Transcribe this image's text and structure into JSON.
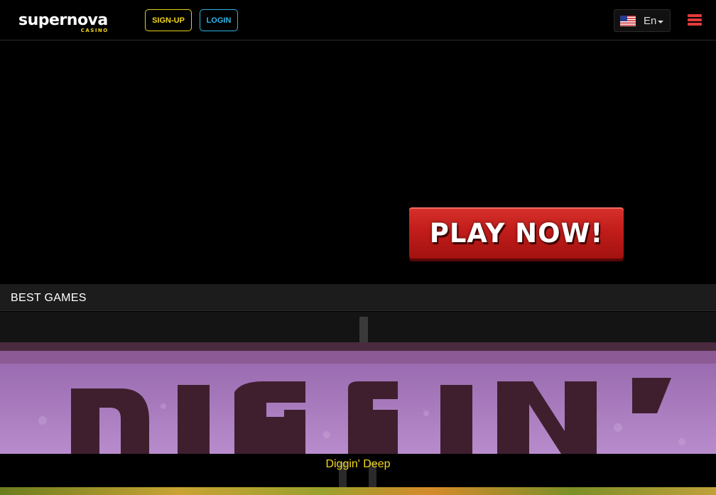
{
  "header": {
    "logo_text": "supernova",
    "logo_sub": "CASINO",
    "signup_label": "SIGN-UP",
    "login_label": "LOGIN",
    "language": "En",
    "flag_icon": "us-flag-icon",
    "menu_icon": "hamburger-menu-icon"
  },
  "hero": {
    "play_label": "PLAY NOW!"
  },
  "best_games": {
    "title": "BEST GAMES",
    "game": {
      "art_text": "DIGGIN'",
      "caption": "Diggin' Deep"
    }
  },
  "colors": {
    "signup": "#f2d61e",
    "login": "#2fb4e6",
    "menu": "#e53a3a",
    "play_button": "#c21d1a",
    "caption": "#f2d61e"
  }
}
